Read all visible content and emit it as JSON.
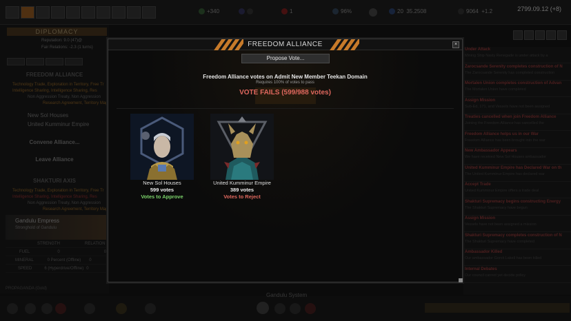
{
  "background": {
    "topbar": {
      "resources": [
        "+340",
        "1",
        "96%",
        "20",
        "35.2508",
        "9064",
        "+1.2"
      ],
      "date": "2799.09.12 (+8)"
    },
    "left_panel": {
      "header": "DIPLOMACY",
      "reputation_line": "Reputation: 9.0 (47)@",
      "relation_line": "Fair Relations: -2.3 (1 turns)",
      "section1": "FREEDOM ALLIANCE",
      "treaty_lines": [
        "Technology Trade, Exploration in Territory, Free Tr",
        "Intelligence Sharing, Intelligence Sharing, Res",
        "Non Aggression Treaty, Non Aggression",
        "Research Agreement, Territory Map"
      ],
      "members": [
        "New Sol Houses",
        "United Kumminur Empire"
      ],
      "convene_label": "Convene Alliance...",
      "leave_label": "Leave Alliance",
      "section2": "SHAKTURI AXIS",
      "planet_name": "Gandulu Empress",
      "planet_sub": "Stronghold of Gandulu",
      "stats_headers": [
        "STRENGTH",
        "RELATION"
      ],
      "stats_rows": [
        [
          "FUEL",
          "0",
          "0"
        ],
        [
          "MINERAL",
          "0 Percent (Offline)",
          "0"
        ],
        [
          "SPEED",
          "6 (Hyperdrive/Offline)",
          "0"
        ]
      ],
      "footer_label": "PROPAGANDA (Gold)"
    },
    "right_panel": {
      "items": [
        {
          "title": "Under Attack",
          "sub": "Mining Ship Nasty Renegade is under attack by a"
        },
        {
          "title": "Zarocsande Serenity completes construction of N",
          "sub": "The Zarocsande Serenity has completed construction"
        },
        {
          "title": "Mortalen Union completes construction of Advan",
          "sub": "The Mortalen Union have completed"
        },
        {
          "title": "Assign Mission",
          "sub": "Sub-Ed, 171, and Vessels have not been assigned"
        },
        {
          "title": "Treaties cancelled when join Freedom Alliance",
          "sub": "Joining the Freedom Alliance has cancelled the"
        },
        {
          "title": "Freedom Alliance helps us in our War",
          "sub": "Freedom Alliance has been brought into the war"
        },
        {
          "title": "New Ambassador Appears",
          "sub": "We have received New Sol Houses ambassador"
        },
        {
          "title": "United Kumminur Empire has Declared War on th",
          "sub": "The United Kumminur Empire has declared war"
        },
        {
          "title": "Accept Trade",
          "sub": "United Kumminur Empire offers a trade deal"
        },
        {
          "title": "Shakturi Supremacy begins constructing Energy",
          "sub": "The Shakturi Supremacy have begun"
        },
        {
          "title": "Assign Mission",
          "sub": "Vessels have not been assigned a mission"
        },
        {
          "title": "Shakturi Supremacy completes construction of N",
          "sub": "The Shakturi Supremacy have completed"
        },
        {
          "title": "Ambassador Killed",
          "sub": "Our ambassador Gorcit Lakell has been killed"
        },
        {
          "title": "Internal Debates",
          "sub": "Our council cannot yet decide policy"
        }
      ]
    },
    "system_label": "Gandulu System"
  },
  "modal": {
    "title": "FREEDOM ALLIANCE",
    "propose_label": "Propose Vote...",
    "vote_title": "Freedom Alliance votes on Admit New Member Teekan Domain",
    "vote_requirement": "Requires 100% of votes to pass",
    "vote_result": "VOTE FAILS (599/988 votes)",
    "close_glyph": "×",
    "voters": [
      {
        "name": "New Sol Houses",
        "votes": "599 votes",
        "stance": "Votes to Approve"
      },
      {
        "name": "United Kumminur Empire",
        "votes": "389 votes",
        "stance": "Votes to Reject"
      }
    ]
  },
  "colors": {
    "accent_orange": "#c77a2a",
    "approve_green": "#7bd26a",
    "reject_red": "#e0685e"
  }
}
